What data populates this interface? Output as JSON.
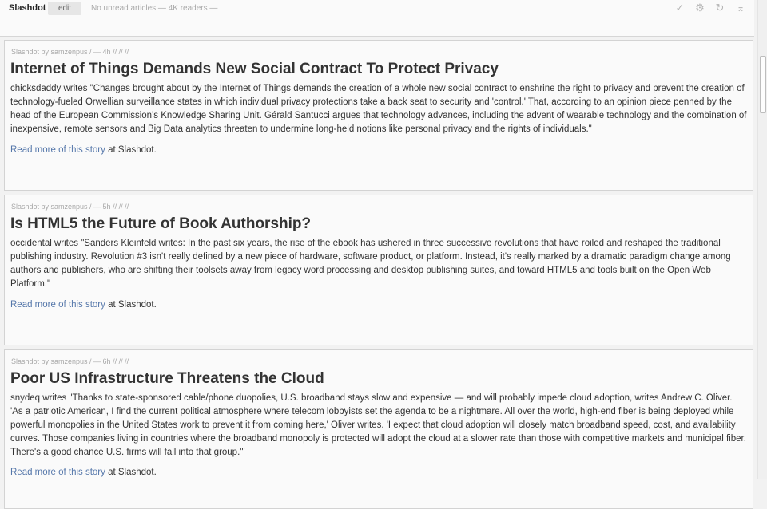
{
  "header": {
    "feed_title": "Slashdot",
    "edit_label": "edit",
    "status": "No unread articles — 4K readers —",
    "icons": [
      "check-icon",
      "gear-icon",
      "refresh-icon",
      "collapse-icon"
    ]
  },
  "articles": [
    {
      "meta": "Slashdot by samzenpus  /  — 4h  //   //   //",
      "title": "Internet of Things Demands New Social Contract To Protect Privacy",
      "body": "chicksdaddy writes \"Changes brought about by the Internet of Things demands the creation of a whole new social contract to enshrine the right to privacy and prevent the creation of technology-fueled Orwellian surveillance states in which individual privacy protections take a back seat to security and 'control.' That, according to an opinion piece penned by the head of the European Commission's Knowledge Sharing Unit. Gérald Santucci argues that technology advances, including the advent of wearable technology and the combination of inexpensive, remote sensors and Big Data analytics threaten to undermine long-held notions like personal privacy and the rights of individuals.\"",
      "read_more": "Read more of this story",
      "read_more_suffix": " at Slashdot."
    },
    {
      "meta": "Slashdot by samzenpus  /  — 5h  //   //   //",
      "title": "Is HTML5 the Future of Book Authorship?",
      "body": "occidental writes \"Sanders Kleinfeld writes: In the past six years, the rise of the ebook has ushered in three successive revolutions that have roiled and reshaped the traditional publishing industry. Revolution #3 isn't really defined by a new piece of hardware, software product, or platform. Instead, it's really marked by a dramatic paradigm change among authors and publishers, who are shifting their toolsets away from legacy word processing and desktop publishing suites, and toward HTML5 and tools built on the Open Web Platform.\"",
      "read_more": "Read more of this story",
      "read_more_suffix": " at Slashdot."
    },
    {
      "meta": "Slashdot by samzenpus  /  — 6h  //   //   //",
      "title": "Poor US Infrastructure Threatens the Cloud",
      "body": "snydeq writes \"Thanks to state-sponsored cable/phone duopolies, U.S. broadband stays slow and expensive — and will probably impede cloud adoption, writes Andrew C. Oliver. 'As a patriotic American, I find the current political atmosphere where telecom lobbyists set the agenda to be a nightmare. All over the world, high-end fiber is being deployed while powerful monopolies in the United States work to prevent it from coming here,' Oliver writes. 'I expect that cloud adoption will closely match broadband speed, cost, and availability curves. Those companies living in countries where the broadband monopoly is protected will adopt the cloud at a slower rate than those with competitive markets and municipal fiber. There's a good chance U.S. firms will fall into that group.'\"",
      "read_more": "Read more of this story",
      "read_more_suffix": " at Slashdot."
    }
  ]
}
